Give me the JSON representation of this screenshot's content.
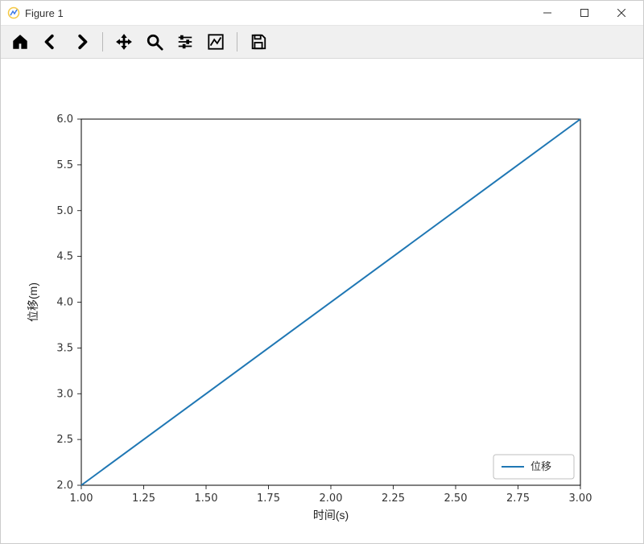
{
  "window": {
    "title": "Figure 1",
    "controls": {
      "minimize": "–",
      "maximize": "▢",
      "close": "✕"
    }
  },
  "toolbar": {
    "items": [
      {
        "name": "home-icon"
      },
      {
        "name": "back-icon"
      },
      {
        "name": "forward-icon"
      },
      {
        "sep": true
      },
      {
        "name": "pan-icon"
      },
      {
        "name": "zoom-icon"
      },
      {
        "name": "configure-icon"
      },
      {
        "name": "axes-edit-icon"
      },
      {
        "sep": true
      },
      {
        "name": "save-icon"
      }
    ]
  },
  "chart_data": {
    "type": "line",
    "series": [
      {
        "name": "位移",
        "x": [
          1.0,
          3.0
        ],
        "y": [
          2.0,
          6.0
        ],
        "color": "#1f77b4"
      }
    ],
    "xlabel": "时间(s)",
    "ylabel": "位移(m)",
    "xlim": [
      1.0,
      3.0
    ],
    "ylim": [
      2.0,
      6.0
    ],
    "xticks": [
      1.0,
      1.25,
      1.5,
      1.75,
      2.0,
      2.25,
      2.5,
      2.75,
      3.0
    ],
    "yticks": [
      2.0,
      2.5,
      3.0,
      3.5,
      4.0,
      4.5,
      5.0,
      5.5,
      6.0
    ],
    "xtick_labels": [
      "1.00",
      "1.25",
      "1.50",
      "1.75",
      "2.00",
      "2.25",
      "2.50",
      "2.75",
      "3.00"
    ],
    "ytick_labels": [
      "2.0",
      "2.5",
      "3.0",
      "3.5",
      "4.0",
      "4.5",
      "5.0",
      "5.5",
      "6.0"
    ],
    "legend": {
      "position": "lower right",
      "entries": [
        "位移"
      ]
    }
  }
}
